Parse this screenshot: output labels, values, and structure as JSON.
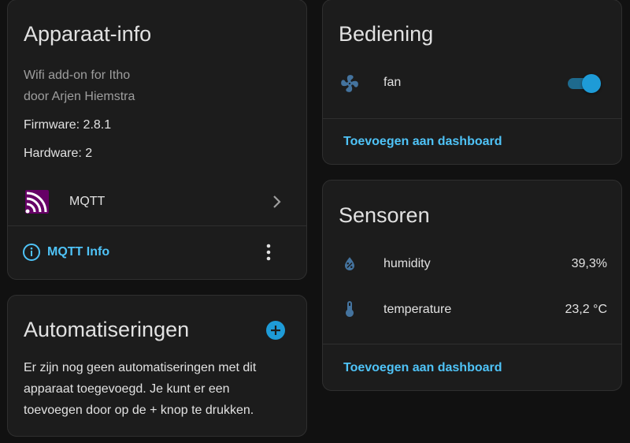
{
  "device_info": {
    "title": "Apparaat-info",
    "model": "Wifi add-on for Itho",
    "manufacturer": "door Arjen Hiemstra",
    "firmware": "Firmware: 2.8.1",
    "hardware": "Hardware: 2",
    "integration_label": "MQTT",
    "mqtt_info_link": "MQTT Info"
  },
  "automations": {
    "title": "Automatiseringen",
    "line1": "Er zijn nog geen automatiseringen met dit",
    "line2": "apparaat toegevoegd. Je kunt er een",
    "line3": "toevoegen door op de + knop te drukken."
  },
  "controls": {
    "title": "Bediening",
    "entity_label": "fan",
    "toggle_state": "on",
    "add_link": "Toevoegen aan dashboard"
  },
  "sensors": {
    "title": "Sensoren",
    "items": [
      {
        "label": "humidity",
        "value": "39,3%",
        "icon": "water-percent-icon"
      },
      {
        "label": "temperature",
        "value": "23,2 °C",
        "icon": "thermometer-icon"
      }
    ],
    "add_link": "Toevoegen aan dashboard"
  },
  "colors": {
    "accent": "#4fc3f7",
    "icon_blue": "#44739e",
    "toggle": "#1e9bd7",
    "mqtt_brand": "#660066"
  }
}
